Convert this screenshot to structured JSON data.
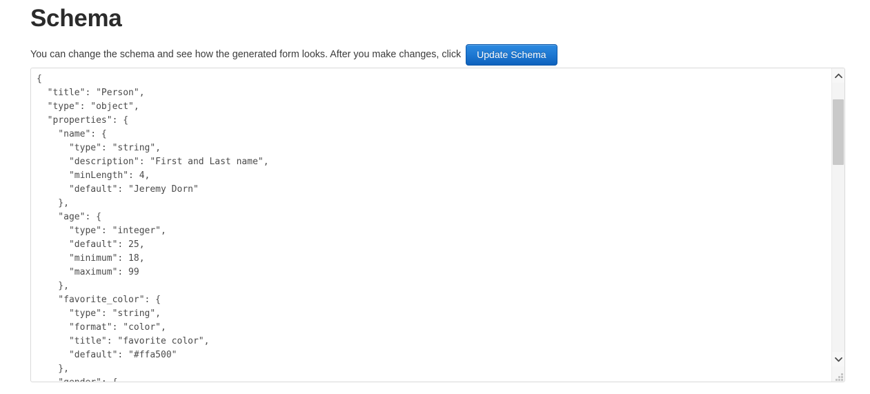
{
  "page": {
    "title": "Schema",
    "intro_text": "You can change the schema and see how the generated form looks. After you make changes, click",
    "update_button_label": "Update Schema"
  },
  "editor": {
    "language": "json",
    "content": "{\n  \"title\": \"Person\",\n  \"type\": \"object\",\n  \"properties\": {\n    \"name\": {\n      \"type\": \"string\",\n      \"description\": \"First and Last name\",\n      \"minLength\": 4,\n      \"default\": \"Jeremy Dorn\"\n    },\n    \"age\": {\n      \"type\": \"integer\",\n      \"default\": 25,\n      \"minimum\": 18,\n      \"maximum\": 99\n    },\n    \"favorite_color\": {\n      \"type\": \"string\",\n      \"format\": \"color\",\n      \"title\": \"favorite color\",\n      \"default\": \"#ffa500\"\n    },\n    \"gender\": {",
    "schema": {
      "title": "Person",
      "type": "object",
      "properties": {
        "name": {
          "type": "string",
          "description": "First and Last name",
          "minLength": 4,
          "default": "Jeremy Dorn"
        },
        "age": {
          "type": "integer",
          "default": 25,
          "minimum": 18,
          "maximum": 99
        },
        "favorite_color": {
          "type": "string",
          "format": "color",
          "title": "favorite color",
          "default": "#ffa500"
        },
        "gender": {}
      }
    },
    "scrollbar": {
      "up_arrow_icon": "chevron-up-icon",
      "down_arrow_icon": "chevron-down-icon",
      "resize_grip_icon": "resize-grip-icon"
    }
  },
  "colors": {
    "accent": "#1f7ad4",
    "accent_border": "#0d57a8",
    "text": "#333333",
    "code_text": "#4a4a4a",
    "border": "#d9d9d9",
    "scroll_thumb": "#c9c9c9"
  }
}
